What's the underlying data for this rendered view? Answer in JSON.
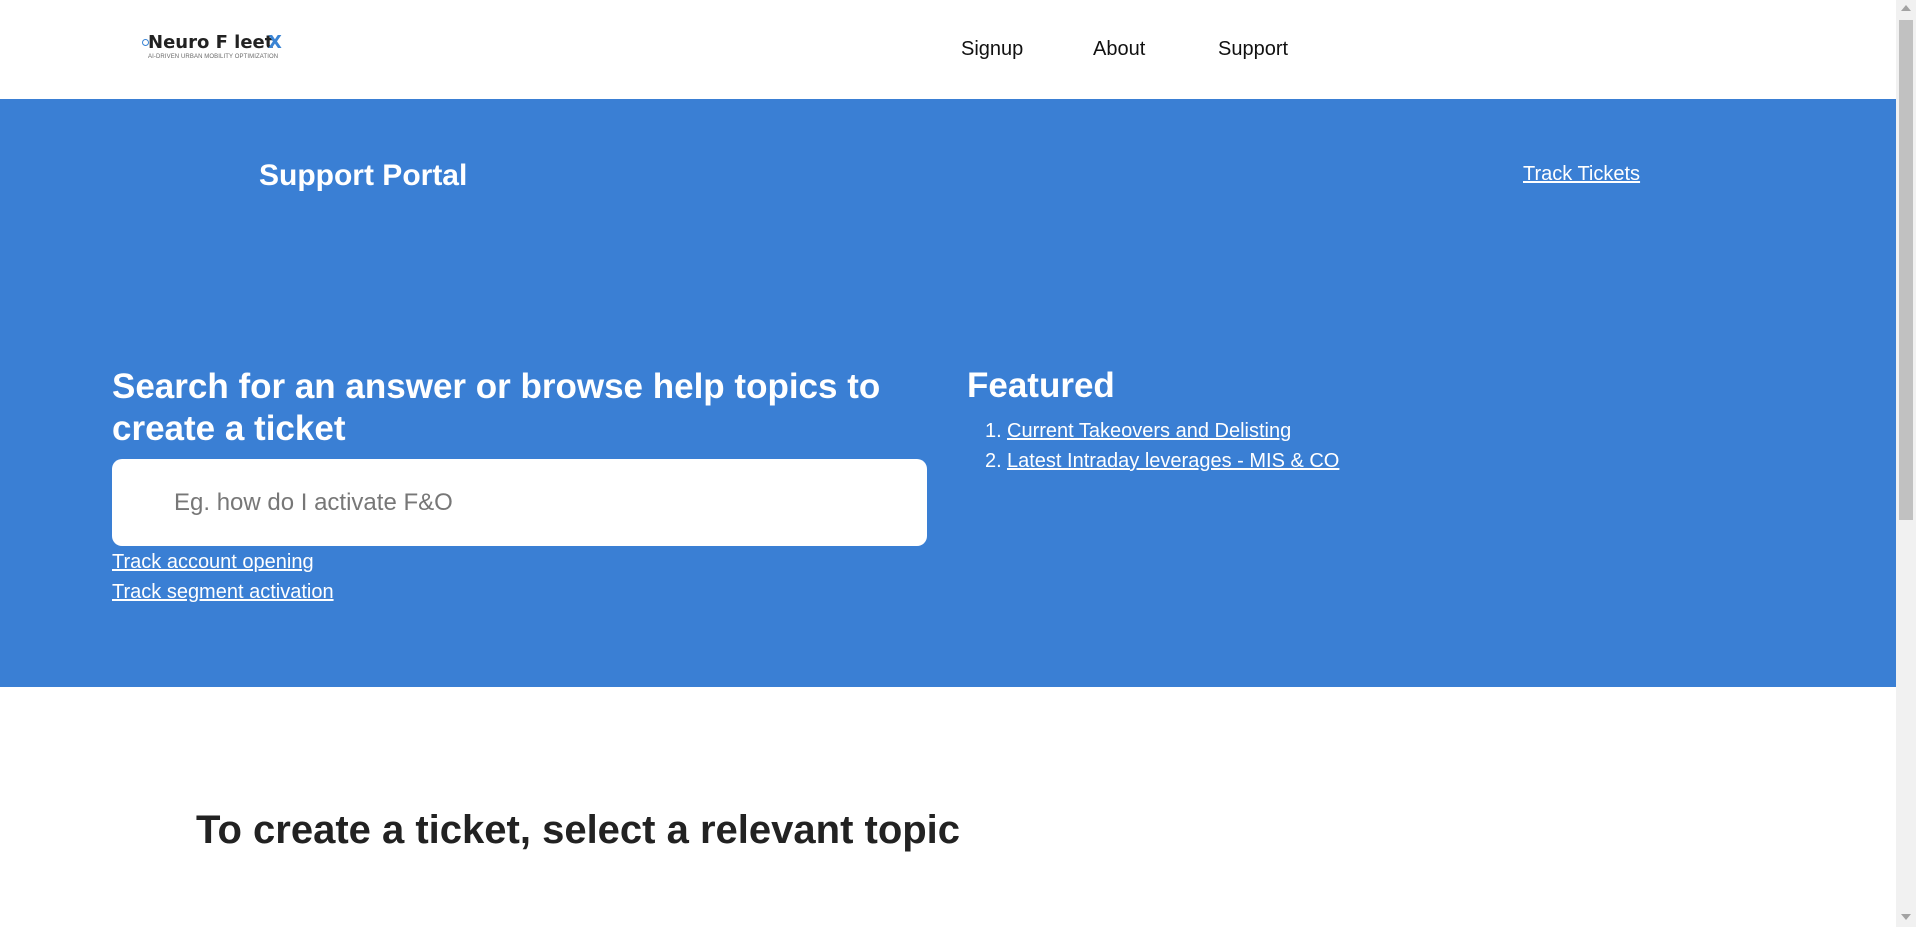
{
  "brand": {
    "name": "Neuro F leet",
    "mark": "X",
    "tagline": "AI-DRIVEN URBAN MOBILITY OPTIMIZATION",
    "accent_color": "#3a84d4"
  },
  "nav": {
    "items": [
      {
        "label": "Signup"
      },
      {
        "label": "About"
      },
      {
        "label": "Support"
      }
    ]
  },
  "hero": {
    "background_color": "#3a7fd4",
    "title": "Support Portal",
    "track_tickets": "Track Tickets",
    "search_heading": "Search for an answer or browse help topics to create a ticket",
    "search_placeholder": "Eg. how do I activate F&O",
    "search_value": "",
    "quick_links": [
      {
        "label": "Track account opening"
      },
      {
        "label": "Track segment activation"
      }
    ],
    "featured": {
      "heading": "Featured",
      "items": [
        {
          "number": "1.",
          "label": "Current Takeovers and Delisting"
        },
        {
          "number": "2.",
          "label": "Latest Intraday leverages - MIS & CO"
        }
      ]
    }
  },
  "topics": {
    "heading": "To create a ticket, select a relevant topic"
  }
}
